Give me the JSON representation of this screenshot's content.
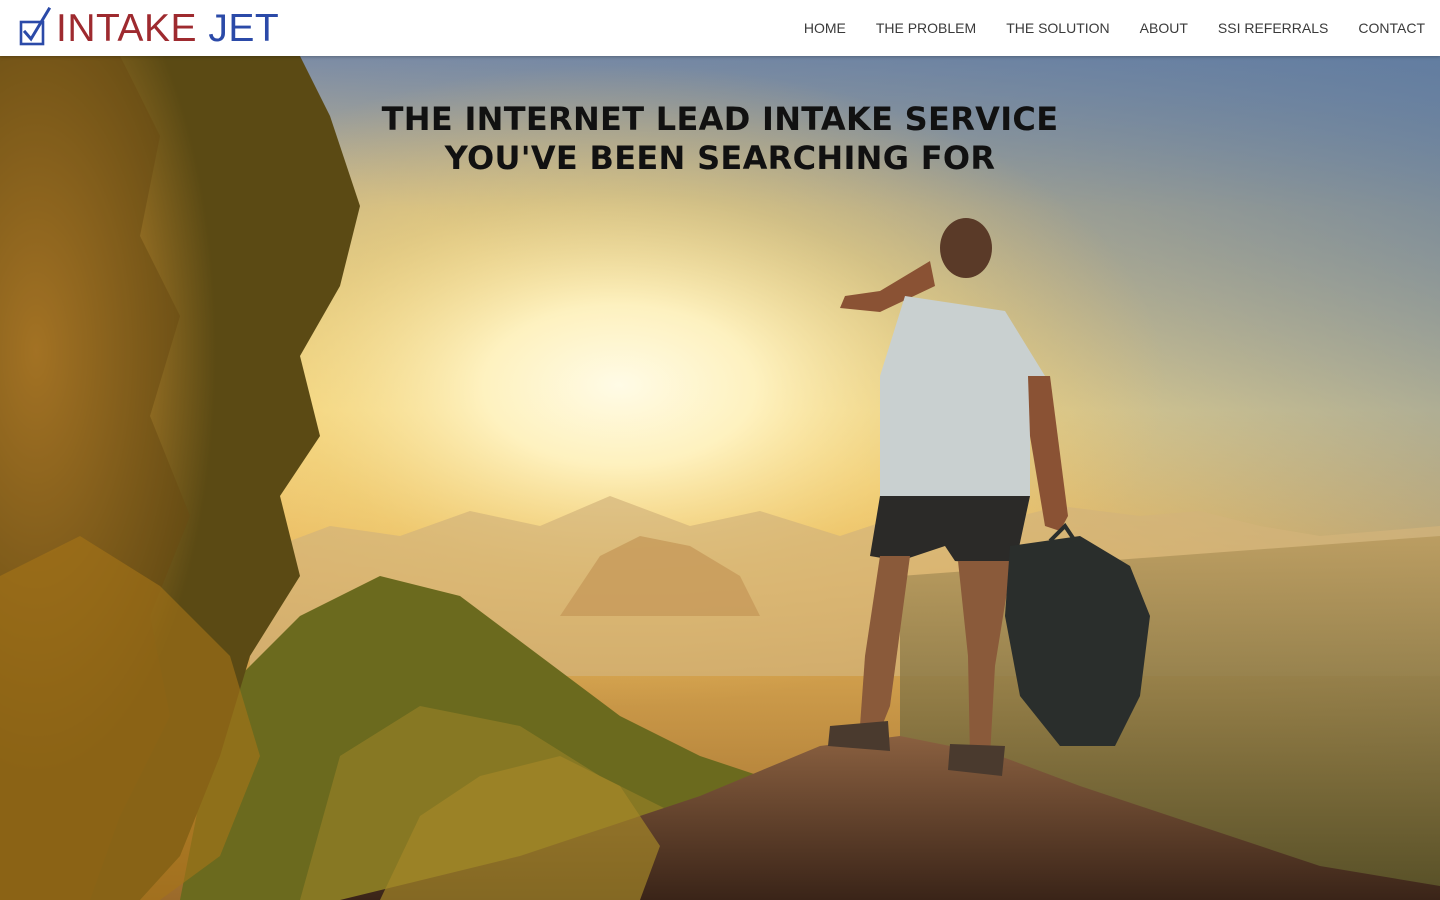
{
  "brand": {
    "name_part1": "INTAKE",
    "name_part2": "JET",
    "logo_icon": "checkbox-check-icon",
    "color_primary": "#9e2a2f",
    "color_secondary": "#2b4aa8"
  },
  "nav": {
    "items": [
      {
        "label": "HOME"
      },
      {
        "label": "THE PROBLEM"
      },
      {
        "label": "THE SOLUTION"
      },
      {
        "label": "ABOUT"
      },
      {
        "label": "SSI REFERRALS"
      },
      {
        "label": "CONTACT"
      }
    ]
  },
  "hero": {
    "title_line1": "THE INTERNET LEAD INTAKE SERVICE",
    "title_line2": "YOU'VE BEEN SEARCHING FOR",
    "image_subject": "hiker on mountain top at sunrise"
  }
}
